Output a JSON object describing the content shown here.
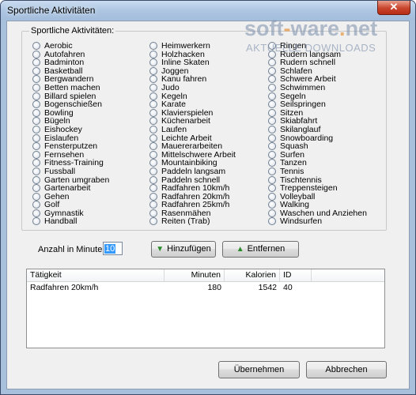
{
  "window": {
    "title": "Sportliche Aktivitäten",
    "close_glyph": "✕"
  },
  "watermark": {
    "brand_part1": "soft",
    "brand_dash": "-",
    "brand_part2": "ware",
    "brand_dot": ".",
    "brand_part3": "net",
    "tagline": "AKTUELLE DOWNLOADS"
  },
  "group": {
    "label": "Sportliche Aktivitäten:",
    "columns": [
      [
        "Aerobic",
        "Autofahren",
        "Badminton",
        "Basketball",
        "Bergwandern",
        "Betten machen",
        "Billard spielen",
        "Bogenschießen",
        "Bowling",
        "Bügeln",
        "Eishockey",
        "Eislaufen",
        "Fensterputzen",
        "Fernsehen",
        "Fitness-Training",
        "Fussball",
        "Garten umgraben",
        "Gartenarbeit",
        "Gehen",
        "Golf",
        "Gymnastik",
        "Handball"
      ],
      [
        "Heimwerkern",
        "Holzhacken",
        "Inline Skaten",
        "Joggen",
        "Kanu fahren",
        "Judo",
        "Kegeln",
        "Karate",
        "Klavierspielen",
        "Küchenarbeit",
        "Laufen",
        "Leichte Arbeit",
        "Mauerer­arbeiten",
        "Mittelschwere Arbeit",
        "Mountainbiking",
        "Paddeln langsam",
        "Paddeln schnell",
        "Radfahren 10km/h",
        "Radfahren 20km/h",
        "Radfahren 25km/h",
        "Rasenmähen",
        "Reiten (Trab)"
      ],
      [
        "Ringen",
        "Rudern langsam",
        "Rudern schnell",
        "Schlafen",
        "Schwere Arbeit",
        "Schwimmen",
        "Segeln",
        "Seilspringen",
        "Sitzen",
        "Skiabfahrt",
        "Skilanglauf",
        "Snowboarding",
        "Squash",
        "Surfen",
        "Tanzen",
        "Tennis",
        "Tischtennis",
        "Treppensteigen",
        "Volleyball",
        "Walking",
        "Waschen und Anziehen",
        "Windsurfen"
      ]
    ]
  },
  "minutes": {
    "label": "Anzahl in Minuten:",
    "value": "10"
  },
  "buttons": {
    "add": "Hinzufügen",
    "remove": "Entfernen",
    "ok": "Übernehmen",
    "cancel": "Abbrechen"
  },
  "table": {
    "columns": [
      "Tätigkeit",
      "Minuten",
      "Kalorien",
      "ID"
    ],
    "rows": [
      [
        "Radfahren 20km/h",
        "180",
        "1542",
        "40"
      ]
    ]
  }
}
